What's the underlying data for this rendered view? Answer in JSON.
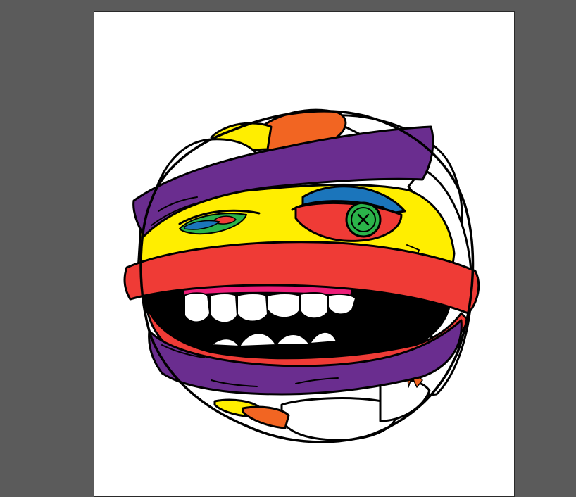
{
  "canvas": {
    "background": "#5b5b5b",
    "artboard_color": "#ffffff"
  },
  "artwork": {
    "subject": "mummy-head-illustration",
    "palette": {
      "purple": "#6a2d8f",
      "yellow": "#ffee00",
      "red": "#ef3b36",
      "orange": "#f26522",
      "blue": "#1b75bb",
      "green": "#2bb34a",
      "pink": "#ec1e79",
      "black": "#000000",
      "white": "#ffffff"
    }
  }
}
